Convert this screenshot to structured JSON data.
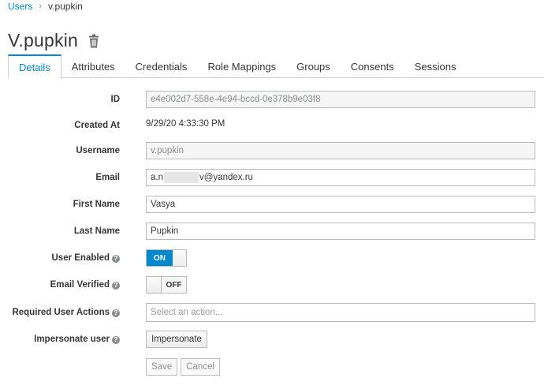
{
  "breadcrumb": {
    "parent": "Users",
    "current": "v.pupkin"
  },
  "page": {
    "title": "V.pupkin"
  },
  "tabs": [
    "Details",
    "Attributes",
    "Credentials",
    "Role Mappings",
    "Groups",
    "Consents",
    "Sessions"
  ],
  "form": {
    "id": {
      "label": "ID",
      "value": "e4e002d7-558e-4e94-bccd-0e378b9e03f8"
    },
    "created_at": {
      "label": "Created At",
      "value": "9/29/20 4:33:30 PM"
    },
    "username": {
      "label": "Username",
      "value": "v.pupkin"
    },
    "email": {
      "label": "Email",
      "value_prefix": "a.n",
      "value_suffix": "v@yandex.ru"
    },
    "first_name": {
      "label": "First Name",
      "value": "Vasya"
    },
    "last_name": {
      "label": "Last Name",
      "value": "Pupkin"
    },
    "user_enabled": {
      "label": "User Enabled",
      "state": "ON"
    },
    "email_verified": {
      "label": "Email Verified",
      "state": "OFF"
    },
    "required_actions": {
      "label": "Required User Actions",
      "placeholder": "Select an action..."
    },
    "impersonate": {
      "label": "Impersonate user",
      "button": "Impersonate"
    }
  },
  "actions": {
    "save": "Save",
    "cancel": "Cancel"
  },
  "colors": {
    "accent": "#0088ce",
    "text": "#363636",
    "border": "#bbbbbb"
  }
}
